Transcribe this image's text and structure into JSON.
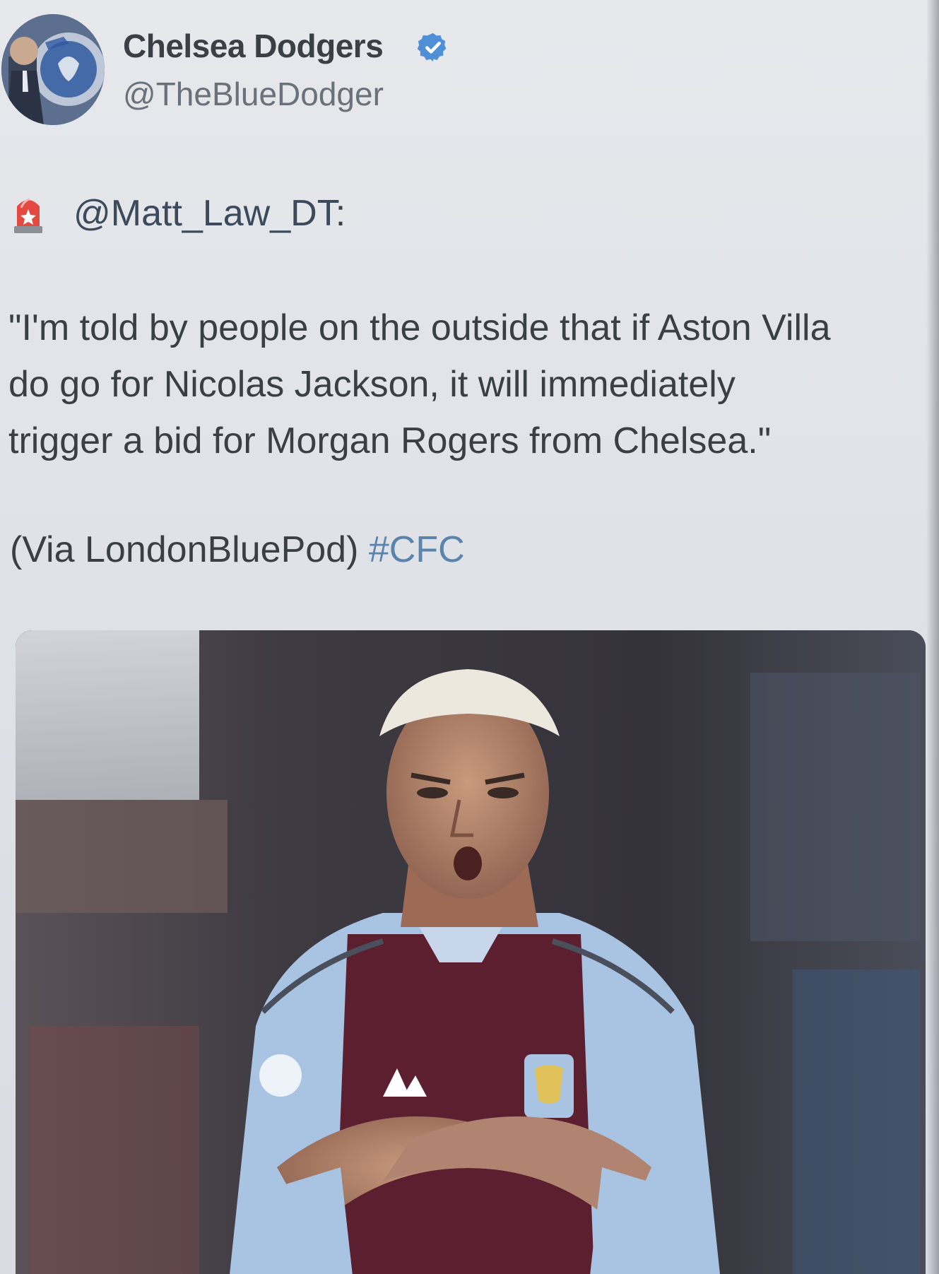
{
  "author": {
    "display_name": "Chelsea Dodgers",
    "handle": "@TheBlueDodger",
    "verified": true,
    "avatar_icon": "chelsea-crest-avatar"
  },
  "post": {
    "siren_icon": "rotating-light-emoji",
    "mention": "@Matt_Law_DT",
    "mention_suffix": ":",
    "quote_lines": [
      "\"I'm told by people on the outside that if Aston Villa",
      "do go for Nicolas Jackson, it will immediately",
      "trigger a bid for Morgan Rogers from Chelsea.\""
    ],
    "via_text": "(Via LondonBluePod)",
    "hashtag": "#CFC"
  },
  "media": {
    "kind": "photo"
  },
  "colors": {
    "link_blue": "#5b84ad",
    "verified_blue": "#4f8fd6",
    "text": "#3a3f46"
  }
}
